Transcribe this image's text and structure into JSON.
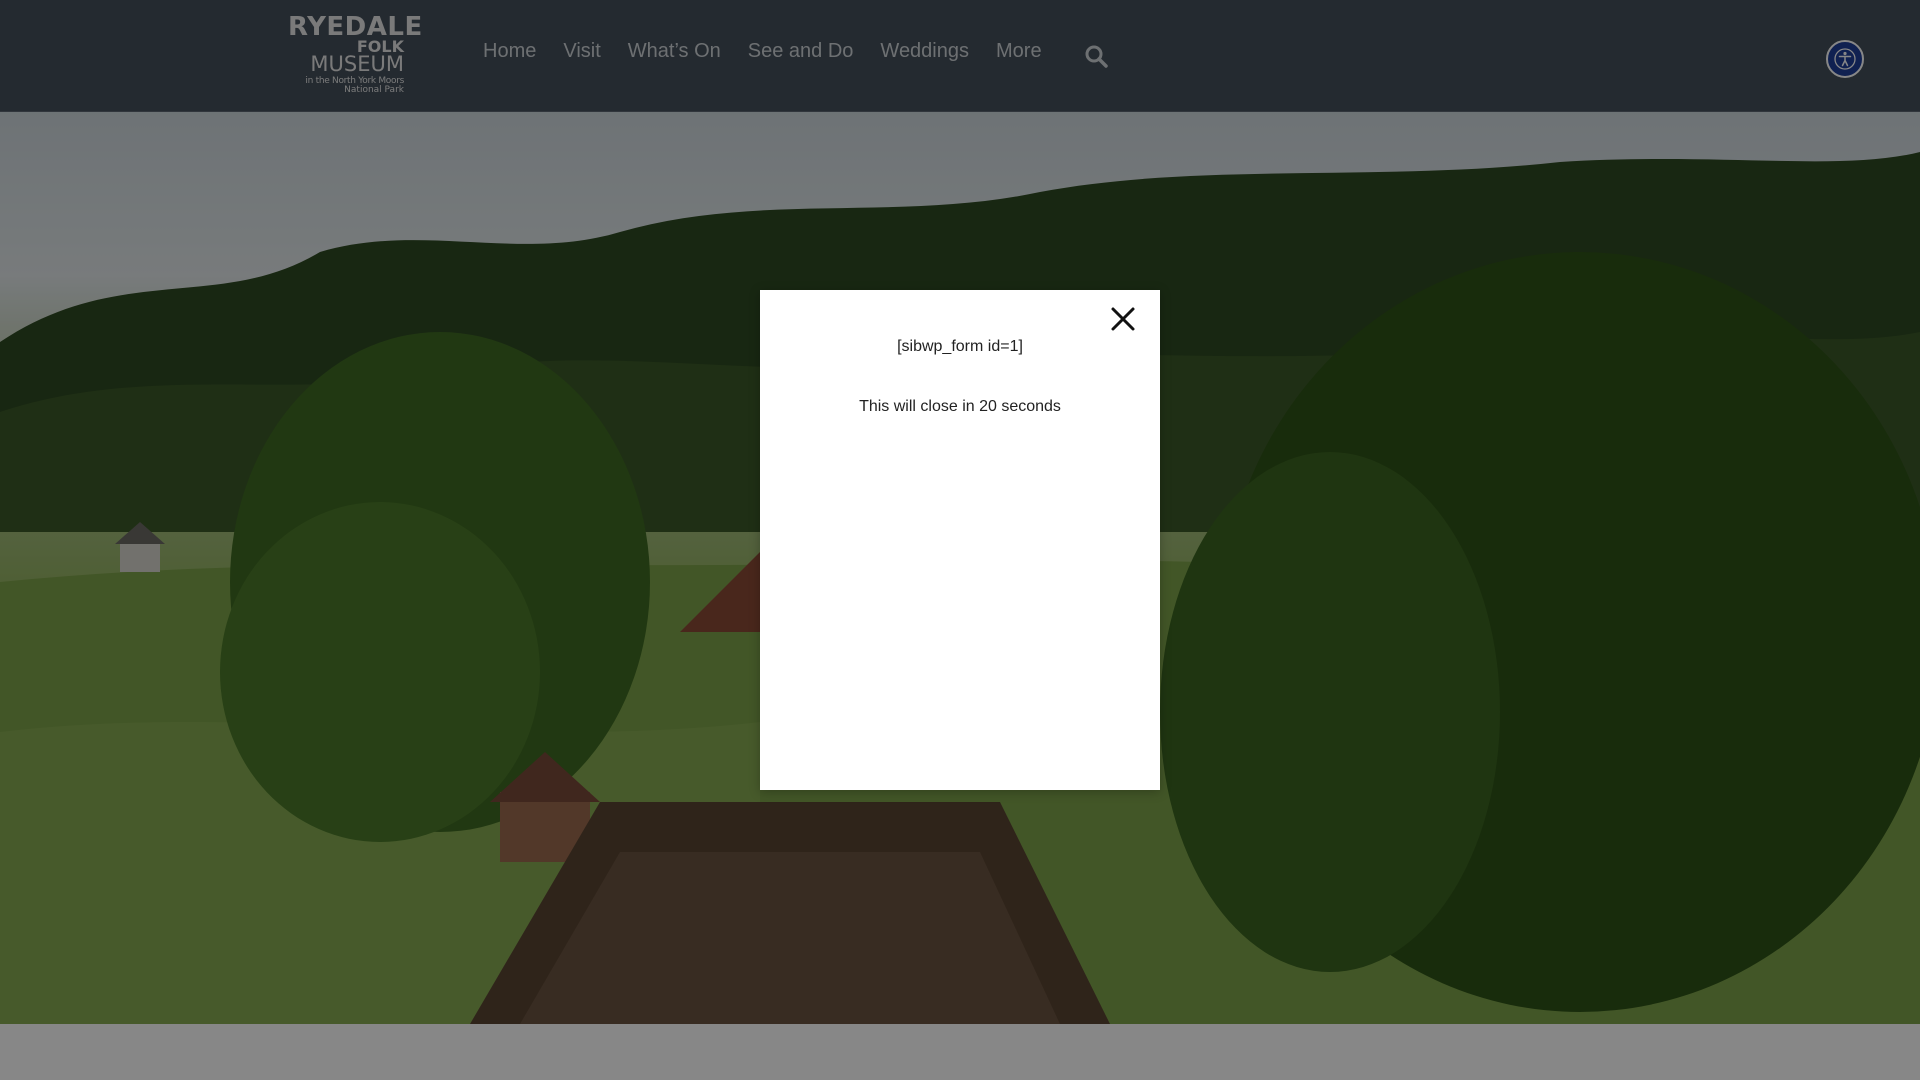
{
  "logo": {
    "line1": "RYEDALE",
    "line2": "FOLK",
    "line3": "MUSEUM",
    "line4": "in the North York Moors",
    "line5": "National Park"
  },
  "nav": {
    "items": [
      {
        "label": "Home"
      },
      {
        "label": "Visit"
      },
      {
        "label": "What’s On"
      },
      {
        "label": "See and Do"
      },
      {
        "label": "Weddings"
      },
      {
        "label": "More"
      }
    ],
    "search_icon": "search-icon"
  },
  "accessibility": {
    "icon": "accessibility-icon",
    "color": "#1f3f9a"
  },
  "modal": {
    "shortcode_text": "[sibwp_form id=1]",
    "countdown_text": "This will close in 20 seconds",
    "close_icon": "close-icon"
  },
  "colors": {
    "header_bg": "#45505c",
    "overlay": "rgba(0,0,0,0.47)",
    "modal_bg": "#ffffff"
  }
}
